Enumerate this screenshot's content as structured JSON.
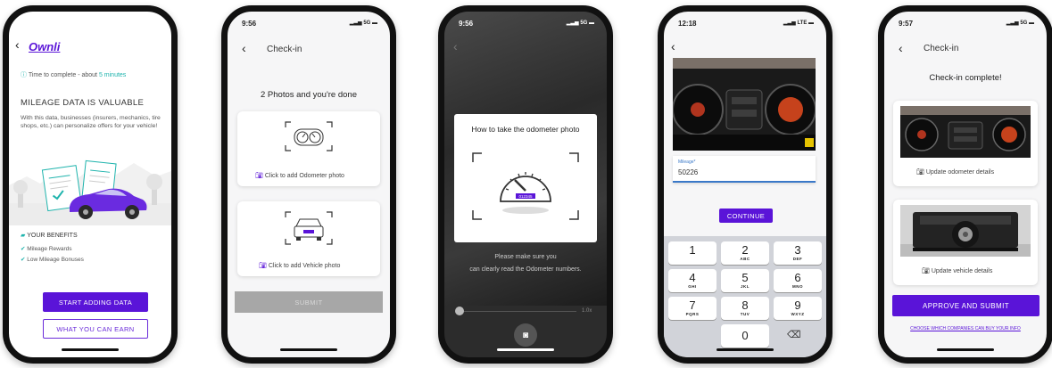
{
  "colors": {
    "brand": "#5a14d8",
    "teal": "#1fb4ad",
    "dark": "#111111"
  },
  "screen1": {
    "back_icon": "chevron-left-icon",
    "logo": "Ownli",
    "time_label": "Time to complete - about",
    "time_value": "5 minutes",
    "heading": "MILEAGE DATA IS VALUABLE",
    "description": "With this data, businesses (insurers, mechanics, tire shops, etc.) can personalize offers for your vehicle!",
    "benefits_title": "YOUR BENEFITS",
    "benefits": [
      "Mileage Rewards",
      "Low Mileage Bonuses"
    ],
    "primary_button": "START ADDING DATA",
    "secondary_button": "WHAT YOU CAN EARN"
  },
  "screen2": {
    "time": "9:56",
    "signal": "5G",
    "title": "Check-in",
    "heading": "2 Photos and you're done",
    "odometer_label": "Click to add Odometer photo",
    "vehicle_label": "Click to add Vehicle photo",
    "submit": "SUBMIT"
  },
  "screen3": {
    "time": "9:56",
    "signal": "5G",
    "modal_title": "How to take the odometer photo",
    "instruction_1": "Please make sure you",
    "instruction_2": "can clearly read the Odometer numbers.",
    "zoom": "1.0x",
    "odometer_digits": "012345"
  },
  "screen4": {
    "time": "12:18",
    "signal": "LTE",
    "mileage_label": "Mileage*",
    "mileage_value": "50226",
    "continue": "CONTINUE",
    "keys": [
      {
        "n": "1",
        "l": ""
      },
      {
        "n": "2",
        "l": "ABC"
      },
      {
        "n": "3",
        "l": "DEF"
      },
      {
        "n": "4",
        "l": "GHI"
      },
      {
        "n": "5",
        "l": "JKL"
      },
      {
        "n": "6",
        "l": "MNO"
      },
      {
        "n": "7",
        "l": "PQRS"
      },
      {
        "n": "8",
        "l": "TUV"
      },
      {
        "n": "9",
        "l": "WXYZ"
      },
      {
        "n": "0",
        "l": ""
      }
    ]
  },
  "screen5": {
    "time": "9:57",
    "signal": "5G",
    "title": "Check-in",
    "heading": "Check-in complete!",
    "update_odometer": "Update odometer details",
    "update_vehicle": "Update vehicle details",
    "approve": "APPROVE AND SUBMIT",
    "choose_link": "CHOOSE WHICH COMPANIES CAN BUY YOUR INFO"
  }
}
